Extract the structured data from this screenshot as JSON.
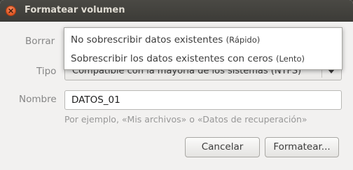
{
  "window": {
    "title": "Formatear volumen"
  },
  "form": {
    "erase_label": "Borrar",
    "type_label": "Tipo",
    "type_value": "Compatible con la mayoría de los sistemas (NTFS)",
    "name_label": "Nombre",
    "name_value": "DATOS_01",
    "name_hint": "Por ejemplo, «Mis archivos» o «Datos de recuperación»"
  },
  "erase_menu": {
    "items": [
      {
        "label": "No sobrescribir datos existentes",
        "note": "(Rápido)"
      },
      {
        "label": "Sobrescribir los datos existentes con ceros",
        "note": "(Lento)"
      }
    ]
  },
  "buttons": {
    "cancel": "Cancelar",
    "format": "Formatear..."
  },
  "icons": {
    "close": "close-icon",
    "dropdown": "chevron-down-icon"
  },
  "colors": {
    "close_button": "#e0521e",
    "titlebar": "#3c3b37"
  }
}
